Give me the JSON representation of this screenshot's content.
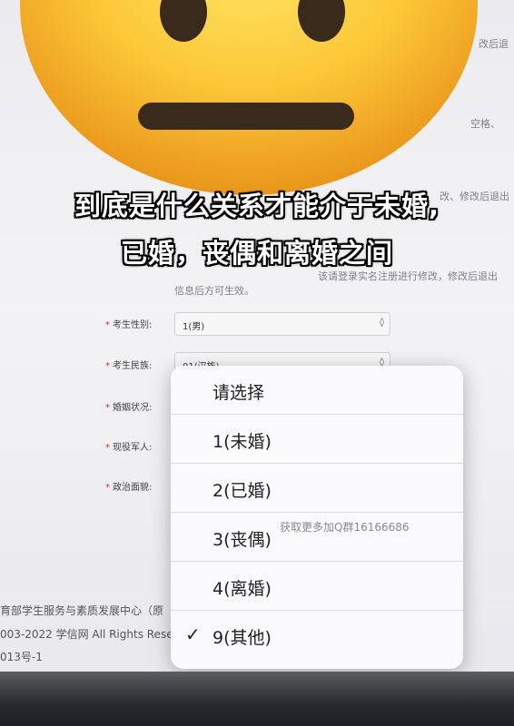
{
  "caption": {
    "line1": "到底是什么关系才能介于未婚,",
    "line2": "已婚，丧偶和离婚之间"
  },
  "background_fragments": {
    "right1": "改后退",
    "right2": "空格、",
    "right3": "改、修改后退出",
    "right4": "该请登录实名注册进行修改，修改后退出",
    "notice": "信息后方可生效。"
  },
  "form": {
    "gender": {
      "label": "考生性别:",
      "value": "1(男)"
    },
    "ethnicity": {
      "label": "考生民族:",
      "value": "01(汉族)"
    },
    "marital": {
      "label": "婚姻状况:"
    },
    "military": {
      "label": "现役军人:"
    },
    "political": {
      "label": "政治面貌:"
    }
  },
  "footer": {
    "line1": "育部学生服务与素质发展中心（原",
    "line2": "003-2022 学信网 All Rights Rese",
    "line3": "013号-1"
  },
  "dropdown": {
    "options": [
      {
        "label": "请选择",
        "selected": false
      },
      {
        "label": "1(未婚)",
        "selected": false
      },
      {
        "label": "2(已婚)",
        "selected": false
      },
      {
        "label": "3(丧偶)",
        "selected": false
      },
      {
        "label": "4(离婚)",
        "selected": false
      },
      {
        "label": "9(其他)",
        "selected": true
      }
    ],
    "check_glyph": "✓"
  },
  "watermark": "获取更多加Q群16166686",
  "overlay_icon": "neutral-face-emoji"
}
